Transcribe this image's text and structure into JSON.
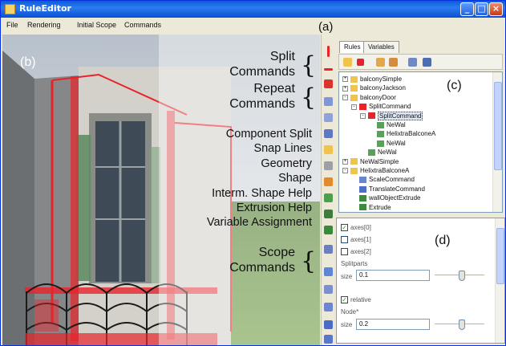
{
  "window": {
    "title": "RuleEditor"
  },
  "menu": {
    "items": [
      "File",
      "Rendering",
      "Initial Scope",
      "Commands"
    ]
  },
  "panel_labels": {
    "a": "(a)",
    "b": "(b)",
    "c": "(c)",
    "d": "(d)"
  },
  "viewport_captions": {
    "split_commands": [
      "Split",
      "Commands"
    ],
    "repeat_commands": [
      "Repeat",
      "Commands"
    ],
    "help_items": [
      "Component Split",
      "Snap Lines",
      "Geometry",
      "Shape",
      "Interm. Shape Help",
      "Extrusion Help",
      "Variable Assignment"
    ],
    "scope_commands": [
      "Scope",
      "Commands"
    ],
    "brace": "{"
  },
  "rules_tabs": [
    "Rules",
    "Variables"
  ],
  "tree": [
    {
      "label": "balconySimple",
      "level": 0,
      "expander": "+",
      "icon": "folder-icon"
    },
    {
      "label": "balconyJackson",
      "level": 0,
      "expander": "+",
      "icon": "folder-icon"
    },
    {
      "label": "balconyDoor",
      "level": 0,
      "expander": "-",
      "icon": "folder-icon"
    },
    {
      "label": "SplitCommand",
      "level": 1,
      "expander": "-",
      "icon": "split-icon"
    },
    {
      "label": "SplitCommand",
      "level": 2,
      "expander": "-",
      "icon": "split-icon",
      "selected": true
    },
    {
      "label": "NeWal",
      "level": 3,
      "expander": "",
      "icon": "shape-icon"
    },
    {
      "label": "HelixtraBalconeA",
      "level": 3,
      "expander": "",
      "icon": "shape-icon"
    },
    {
      "label": "NeWal",
      "level": 3,
      "expander": "",
      "icon": "shape-icon"
    },
    {
      "label": "NeWal",
      "level": 2,
      "expander": "",
      "icon": "shape-icon"
    },
    {
      "label": "NeWalSimple",
      "level": 0,
      "expander": "+",
      "icon": "folder-icon"
    },
    {
      "label": "HelixtraBalconeA",
      "level": 0,
      "expander": "-",
      "icon": "folder-icon"
    },
    {
      "label": "ScaleCommand",
      "level": 1,
      "expander": "",
      "icon": "scale-icon"
    },
    {
      "label": "TranslateCommand",
      "level": 1,
      "expander": "",
      "icon": "translate-icon"
    },
    {
      "label": "wallObjectExtrude",
      "level": 1,
      "expander": "",
      "icon": "extrude-icon"
    },
    {
      "label": "Extrude",
      "level": 1,
      "expander": "",
      "icon": "extrude-icon"
    }
  ],
  "properties": {
    "axes": [
      {
        "label": "axes[0]",
        "checked": true
      },
      {
        "label": "axes[1]",
        "checked": false
      },
      {
        "label": "axes[2]",
        "checked": false
      }
    ],
    "split_parts_label": "Splitparts",
    "size_label_1": "size",
    "size_value_1": "0.1",
    "relative_label": "relative",
    "relative_checked": true,
    "node_label": "Node*",
    "size_label_2": "size",
    "size_value_2": "0.2"
  },
  "colors": {
    "accent_red": "#e8232a",
    "titlebar_blue": "#0a5bd9",
    "window_bg": "#ece9d8"
  }
}
